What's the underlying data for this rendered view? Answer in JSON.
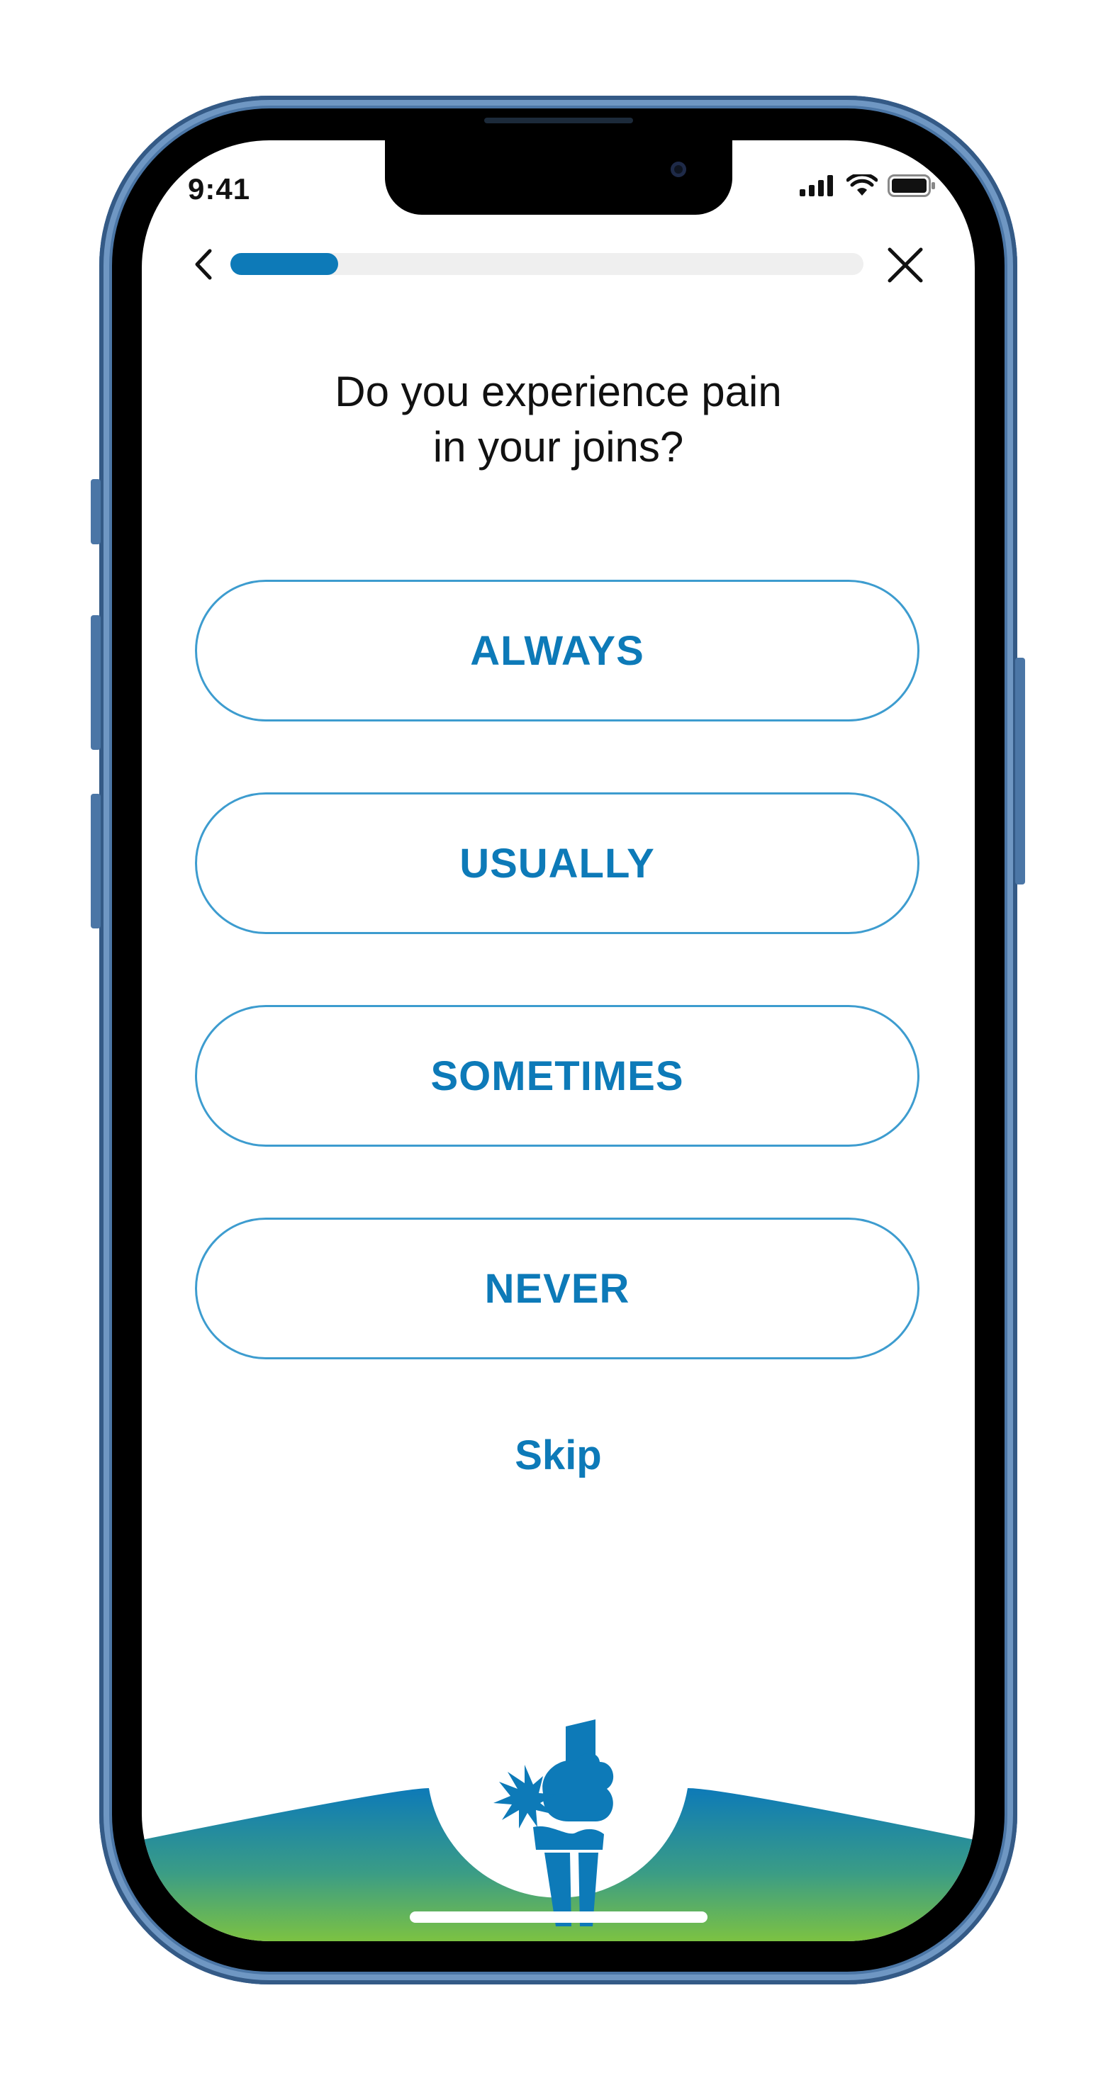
{
  "status_bar": {
    "time": "9:41",
    "icons": [
      "cellular-signal-icon",
      "wifi-icon",
      "battery-icon"
    ]
  },
  "top_bar": {
    "back_icon": "chevron-left-icon",
    "close_icon": "close-icon",
    "progress_fraction": 0.17
  },
  "question": "Do you experience pain\nin your joins?",
  "options": [
    {
      "label": "ALWAYS"
    },
    {
      "label": "USUALLY"
    },
    {
      "label": "SOMETIMES"
    },
    {
      "label": "NEVER"
    }
  ],
  "skip_label": "Skip",
  "illustration_icon": "knee-joint-pain-icon",
  "colors": {
    "accent": "#0d7ab8",
    "option_border": "#3d9ccf",
    "gradient_top": "#0d7ab8",
    "gradient_bottom": "#7cc242",
    "frame": "#4b76a6"
  }
}
